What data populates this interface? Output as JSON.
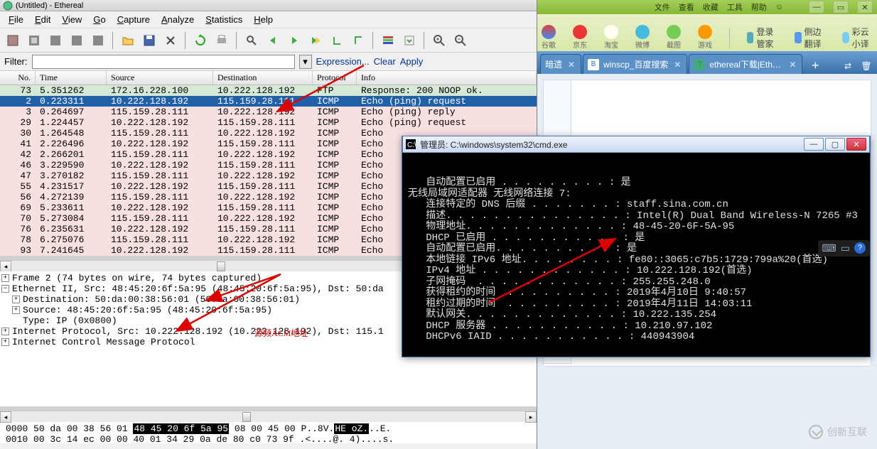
{
  "ethereal": {
    "title": "(Untitled) - Ethereal",
    "menu": [
      "File",
      "Edit",
      "View",
      "Go",
      "Capture",
      "Analyze",
      "Statistics",
      "Help"
    ],
    "filter_label": "Filter:",
    "filter_value": "",
    "links": {
      "expression": "Expression...",
      "clear": "Clear",
      "apply": "Apply"
    },
    "cols": {
      "no": "No.",
      "time": "Time",
      "src": "Source",
      "dst": "Destination",
      "proto": "Protocol",
      "info": "Info"
    },
    "rows": [
      {
        "no": "73",
        "t": "5.351262",
        "s": "172.16.228.100",
        "d": "10.222.128.192",
        "p": "FTP",
        "i": "Response: 200 NOOP ok.",
        "cls": "green"
      },
      {
        "no": "2",
        "t": "0.223311",
        "s": "10.222.128.192",
        "d": "115.159.28.111",
        "p": "ICMP",
        "i": "Echo (ping) request",
        "cls": "sel"
      },
      {
        "no": "3",
        "t": "0.264697",
        "s": "115.159.28.111",
        "d": "10.222.128.192",
        "p": "ICMP",
        "i": "Echo (ping) reply",
        "cls": "pink"
      },
      {
        "no": "29",
        "t": "1.224457",
        "s": "10.222.128.192",
        "d": "115.159.28.111",
        "p": "ICMP",
        "i": "Echo (ping) request",
        "cls": "pink"
      },
      {
        "no": "30",
        "t": "1.264548",
        "s": "115.159.28.111",
        "d": "10.222.128.192",
        "p": "ICMP",
        "i": "Echo",
        "cls": "pink"
      },
      {
        "no": "41",
        "t": "2.226496",
        "s": "10.222.128.192",
        "d": "115.159.28.111",
        "p": "ICMP",
        "i": "Echo",
        "cls": "pink"
      },
      {
        "no": "42",
        "t": "2.266201",
        "s": "115.159.28.111",
        "d": "10.222.128.192",
        "p": "ICMP",
        "i": "Echo",
        "cls": "pink"
      },
      {
        "no": "46",
        "t": "3.229590",
        "s": "10.222.128.192",
        "d": "115.159.28.111",
        "p": "ICMP",
        "i": "Echo",
        "cls": "pink"
      },
      {
        "no": "47",
        "t": "3.270182",
        "s": "115.159.28.111",
        "d": "10.222.128.192",
        "p": "ICMP",
        "i": "Echo",
        "cls": "pink"
      },
      {
        "no": "55",
        "t": "4.231517",
        "s": "10.222.128.192",
        "d": "115.159.28.111",
        "p": "ICMP",
        "i": "Echo",
        "cls": "pink"
      },
      {
        "no": "56",
        "t": "4.272139",
        "s": "115.159.28.111",
        "d": "10.222.128.192",
        "p": "ICMP",
        "i": "Echo",
        "cls": "pink"
      },
      {
        "no": "69",
        "t": "5.233611",
        "s": "10.222.128.192",
        "d": "115.159.28.111",
        "p": "ICMP",
        "i": "Echo",
        "cls": "pink"
      },
      {
        "no": "70",
        "t": "5.273084",
        "s": "115.159.28.111",
        "d": "10.222.128.192",
        "p": "ICMP",
        "i": "Echo",
        "cls": "pink"
      },
      {
        "no": "76",
        "t": "6.235631",
        "s": "10.222.128.192",
        "d": "115.159.28.111",
        "p": "ICMP",
        "i": "Echo",
        "cls": "pink"
      },
      {
        "no": "78",
        "t": "6.275076",
        "s": "115.159.28.111",
        "d": "10.222.128.192",
        "p": "ICMP",
        "i": "Echo",
        "cls": "pink"
      },
      {
        "no": "93",
        "t": "7.241645",
        "s": "10.222.128.192",
        "d": "115.159.28.111",
        "p": "ICMP",
        "i": "Echo",
        "cls": "pink"
      },
      {
        "no": "94",
        "t": "7.281136",
        "s": "115.159.28.111",
        "d": "10.222.128.192",
        "p": "ICMP",
        "i": "Echo",
        "cls": "pink"
      }
    ],
    "tree": {
      "l1": "Frame 2 (74 bytes on wire, 74 bytes captured)",
      "l2": "Ethernet II, Src: 48:45:20:6f:5a:95 (48:45:20:6f:5a:95), Dst: 50:da",
      "l3": "Destination: 50:da:00:38:56:01 (50:da:00:38:56:01)",
      "l4": "Source: 48:45:20:6f:5a:95 (48:45:20:6f:5a:95)",
      "l5": "Type: IP (0x0800)",
      "l6": "Internet Protocol, Src: 10.222.128.192 (10.222.128.192), Dst: 115.1",
      "l7": "Internet Control Message Protocol",
      "overlay": "源频ACM地址"
    },
    "hex": {
      "offset1": "0000",
      "b1a": "50 da 00 38 56 01 ",
      "b1hl": "48 45  20 6f 5a 95",
      "b1b": " 08 00 45 00",
      "a1a": "P..8V.",
      "a1hl": "HE  oZ.",
      "a1b": "..E.",
      "offset2": "0010",
      "b2": "00 3c 14 ec 00 00 40 01  34 29 0a de 80 c0 73 9f",
      "a2": ".<....@.  4)....s."
    }
  },
  "browser": {
    "topmenu": [
      "文件",
      "查看",
      "收藏",
      "工具",
      "帮助"
    ],
    "quick_icons": [
      "谷歌",
      "京东",
      "淘宝",
      "微博",
      "截图",
      "游戏"
    ],
    "links": [
      "登录管家",
      "侧边翻译",
      "彩云小译"
    ],
    "tabs": [
      {
        "label": "暗遗",
        "trunc": true
      },
      {
        "label": "winscp_百度搜索",
        "fav": "B"
      },
      {
        "label": "ethereal下载|Ethere",
        "fav": "?"
      }
    ]
  },
  "cmd": {
    "title": "管理员: C:\\windows\\system32\\cmd.exe",
    "lines": [
      "   自动配置已启用 . . . . . . . . . : 是",
      "",
      "无线局域网适配器 无线网络连接 7:",
      "",
      "   连接特定的 DNS 后缀 . . . . . . . : staff.sina.com.cn",
      "   描述. . . . . . . . . . . . . . . : Intel(R) Dual Band Wireless-N 7265 #3",
      "   物理地址. . . . . . . . . . . . . : 48-45-20-6F-5A-95",
      "   DHCP 已启用 . . . . . . . . . . . : 是",
      "   自动配置已启用. . . . . . . . . . : 是",
      "   本地链接 IPv6 地址. . . . . . . . : fe80::3065:c7b5:1729:799a%20(首选)",
      "   IPv4 地址 . . . . . . . . . . . . : 10.222.128.192(首选)",
      "   子网掩码  . . . . . . . . . . . . : 255.255.248.0",
      "   获得租约的时间  . . . . . . . . . : 2019年4月10日 9:40:57",
      "   租约过期的时间  . . . . . . . . . : 2019年4月11日 14:03:11",
      "   默认网关. . . . . . . . . . . . . : 10.222.135.254",
      "   DHCP 服务器 . . . . . . . . . . . : 10.210.97.102",
      "   DHCPv6 IAID . . . . . . . . . . . : 440943904"
    ]
  },
  "watermark": "创新互联"
}
